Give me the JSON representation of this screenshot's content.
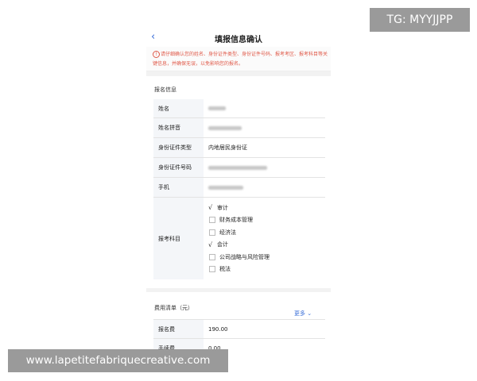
{
  "watermarks": {
    "top_right": "TG: MYYJJPP",
    "bottom_left": "www.lapetitefabriquecreative.com"
  },
  "nav": {
    "back_icon": "chevron-left-icon",
    "back_glyph": "‹",
    "title": "填报信息确认"
  },
  "notice": {
    "icon": "info-icon",
    "icon_glyph": "!",
    "text": "请仔细确认您的姓名、身份证件类型、身份证件号码、报考考区、报考科目等关键信息，并确保无误，以免影响您的报名。"
  },
  "registration": {
    "section_title": "报名信息",
    "rows": [
      {
        "label": "姓名",
        "value": ""
      },
      {
        "label": "姓名拼音",
        "value": ""
      },
      {
        "label": "身份证件类型",
        "value": "内地居民身份证"
      },
      {
        "label": "身份证件号码",
        "value": ""
      },
      {
        "label": "手机",
        "value": ""
      }
    ],
    "subjects_label": "报考科目",
    "check_glyph": "√",
    "subjects": [
      {
        "name": "审计",
        "checked": true
      },
      {
        "name": "财务成本管理",
        "checked": false
      },
      {
        "name": "经济法",
        "checked": false
      },
      {
        "name": "会计",
        "checked": true
      },
      {
        "name": "公司战略与风险管理",
        "checked": false
      },
      {
        "name": "税法",
        "checked": false
      }
    ],
    "more_label": "更多",
    "more_icon": "chevron-down-icon",
    "more_glyph": "⌄"
  },
  "fees": {
    "section_title": "费用清单（元）",
    "rows": [
      {
        "label": "报名费",
        "value": "190.00"
      },
      {
        "label": "手续费",
        "value": "0.00"
      }
    ]
  },
  "colors": {
    "accent": "#3a6fd8",
    "notice": "#e05a4a",
    "label_bg": "#f4f6f9",
    "watermark_bg": "#9a9a9a"
  }
}
